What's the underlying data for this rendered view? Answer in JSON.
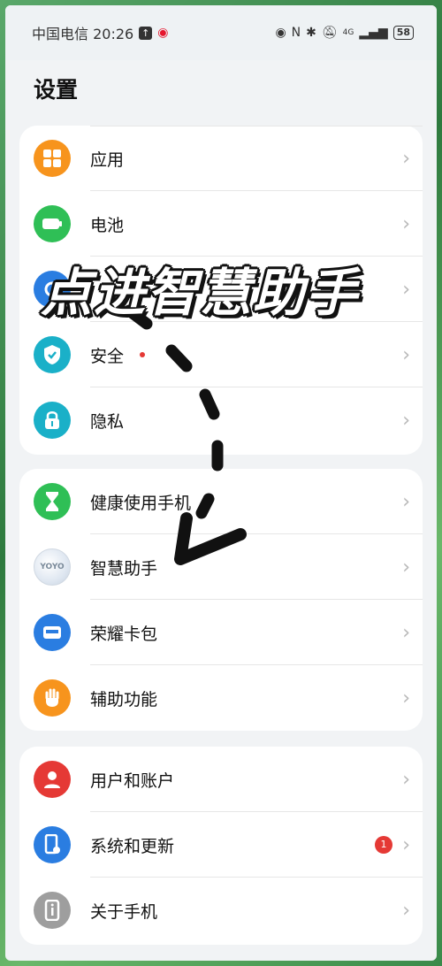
{
  "status_bar": {
    "carrier_time": "中国电信 20:26",
    "battery": "58",
    "network": "4G"
  },
  "header": {
    "title": "设置"
  },
  "group1": {
    "items": [
      {
        "label": "应用",
        "icon": "apps-icon",
        "color": "#f7941d"
      },
      {
        "label": "电池",
        "icon": "battery-icon",
        "color": "#2fbf56"
      },
      {
        "label": "",
        "icon": "storage-icon",
        "color": "#2a7de1"
      },
      {
        "label": "安全",
        "icon": "shield-icon",
        "color": "#1ab0c8"
      },
      {
        "label": "隐私",
        "icon": "lock-icon",
        "color": "#1ab0c8"
      }
    ]
  },
  "group2": {
    "items": [
      {
        "label": "健康使用手机",
        "icon": "hourglass-icon",
        "color": "#2fbf56"
      },
      {
        "label": "智慧助手",
        "icon": "yoyo-icon",
        "color": "#dde6ef"
      },
      {
        "label": "荣耀卡包",
        "icon": "wallet-icon",
        "color": "#2a7de1"
      },
      {
        "label": "辅助功能",
        "icon": "hand-icon",
        "color": "#f7941d"
      }
    ]
  },
  "group3": {
    "items": [
      {
        "label": "用户和账户",
        "icon": "user-icon",
        "color": "#e53935"
      },
      {
        "label": "系统和更新",
        "icon": "phone-gear-icon",
        "color": "#2a7de1",
        "badge": "1"
      },
      {
        "label": "关于手机",
        "icon": "info-phone-icon",
        "color": "#9e9e9e"
      }
    ]
  },
  "yoyo_icon_text": "YOYO",
  "overlay": {
    "text": "点进智慧助手"
  },
  "chevron": "›"
}
